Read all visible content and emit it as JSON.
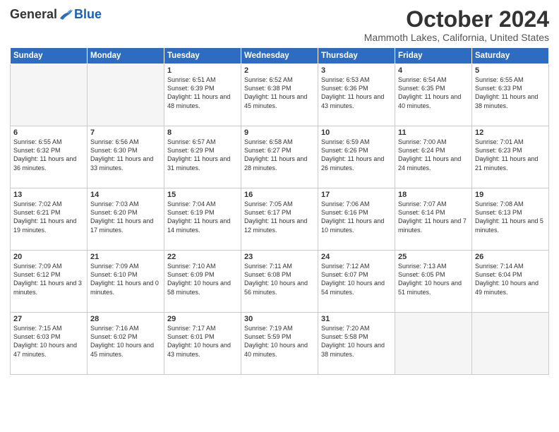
{
  "logo": {
    "general": "General",
    "blue": "Blue"
  },
  "title": "October 2024",
  "location": "Mammoth Lakes, California, United States",
  "weekdays": [
    "Sunday",
    "Monday",
    "Tuesday",
    "Wednesday",
    "Thursday",
    "Friday",
    "Saturday"
  ],
  "weeks": [
    [
      {
        "day": "",
        "empty": true
      },
      {
        "day": "",
        "empty": true
      },
      {
        "day": "1",
        "sunrise": "Sunrise: 6:51 AM",
        "sunset": "Sunset: 6:39 PM",
        "daylight": "Daylight: 11 hours and 48 minutes."
      },
      {
        "day": "2",
        "sunrise": "Sunrise: 6:52 AM",
        "sunset": "Sunset: 6:38 PM",
        "daylight": "Daylight: 11 hours and 45 minutes."
      },
      {
        "day": "3",
        "sunrise": "Sunrise: 6:53 AM",
        "sunset": "Sunset: 6:36 PM",
        "daylight": "Daylight: 11 hours and 43 minutes."
      },
      {
        "day": "4",
        "sunrise": "Sunrise: 6:54 AM",
        "sunset": "Sunset: 6:35 PM",
        "daylight": "Daylight: 11 hours and 40 minutes."
      },
      {
        "day": "5",
        "sunrise": "Sunrise: 6:55 AM",
        "sunset": "Sunset: 6:33 PM",
        "daylight": "Daylight: 11 hours and 38 minutes."
      }
    ],
    [
      {
        "day": "6",
        "sunrise": "Sunrise: 6:55 AM",
        "sunset": "Sunset: 6:32 PM",
        "daylight": "Daylight: 11 hours and 36 minutes."
      },
      {
        "day": "7",
        "sunrise": "Sunrise: 6:56 AM",
        "sunset": "Sunset: 6:30 PM",
        "daylight": "Daylight: 11 hours and 33 minutes."
      },
      {
        "day": "8",
        "sunrise": "Sunrise: 6:57 AM",
        "sunset": "Sunset: 6:29 PM",
        "daylight": "Daylight: 11 hours and 31 minutes."
      },
      {
        "day": "9",
        "sunrise": "Sunrise: 6:58 AM",
        "sunset": "Sunset: 6:27 PM",
        "daylight": "Daylight: 11 hours and 28 minutes."
      },
      {
        "day": "10",
        "sunrise": "Sunrise: 6:59 AM",
        "sunset": "Sunset: 6:26 PM",
        "daylight": "Daylight: 11 hours and 26 minutes."
      },
      {
        "day": "11",
        "sunrise": "Sunrise: 7:00 AM",
        "sunset": "Sunset: 6:24 PM",
        "daylight": "Daylight: 11 hours and 24 minutes."
      },
      {
        "day": "12",
        "sunrise": "Sunrise: 7:01 AM",
        "sunset": "Sunset: 6:23 PM",
        "daylight": "Daylight: 11 hours and 21 minutes."
      }
    ],
    [
      {
        "day": "13",
        "sunrise": "Sunrise: 7:02 AM",
        "sunset": "Sunset: 6:21 PM",
        "daylight": "Daylight: 11 hours and 19 minutes."
      },
      {
        "day": "14",
        "sunrise": "Sunrise: 7:03 AM",
        "sunset": "Sunset: 6:20 PM",
        "daylight": "Daylight: 11 hours and 17 minutes."
      },
      {
        "day": "15",
        "sunrise": "Sunrise: 7:04 AM",
        "sunset": "Sunset: 6:19 PM",
        "daylight": "Daylight: 11 hours and 14 minutes."
      },
      {
        "day": "16",
        "sunrise": "Sunrise: 7:05 AM",
        "sunset": "Sunset: 6:17 PM",
        "daylight": "Daylight: 11 hours and 12 minutes."
      },
      {
        "day": "17",
        "sunrise": "Sunrise: 7:06 AM",
        "sunset": "Sunset: 6:16 PM",
        "daylight": "Daylight: 11 hours and 10 minutes."
      },
      {
        "day": "18",
        "sunrise": "Sunrise: 7:07 AM",
        "sunset": "Sunset: 6:14 PM",
        "daylight": "Daylight: 11 hours and 7 minutes."
      },
      {
        "day": "19",
        "sunrise": "Sunrise: 7:08 AM",
        "sunset": "Sunset: 6:13 PM",
        "daylight": "Daylight: 11 hours and 5 minutes."
      }
    ],
    [
      {
        "day": "20",
        "sunrise": "Sunrise: 7:09 AM",
        "sunset": "Sunset: 6:12 PM",
        "daylight": "Daylight: 11 hours and 3 minutes."
      },
      {
        "day": "21",
        "sunrise": "Sunrise: 7:09 AM",
        "sunset": "Sunset: 6:10 PM",
        "daylight": "Daylight: 11 hours and 0 minutes."
      },
      {
        "day": "22",
        "sunrise": "Sunrise: 7:10 AM",
        "sunset": "Sunset: 6:09 PM",
        "daylight": "Daylight: 10 hours and 58 minutes."
      },
      {
        "day": "23",
        "sunrise": "Sunrise: 7:11 AM",
        "sunset": "Sunset: 6:08 PM",
        "daylight": "Daylight: 10 hours and 56 minutes."
      },
      {
        "day": "24",
        "sunrise": "Sunrise: 7:12 AM",
        "sunset": "Sunset: 6:07 PM",
        "daylight": "Daylight: 10 hours and 54 minutes."
      },
      {
        "day": "25",
        "sunrise": "Sunrise: 7:13 AM",
        "sunset": "Sunset: 6:05 PM",
        "daylight": "Daylight: 10 hours and 51 minutes."
      },
      {
        "day": "26",
        "sunrise": "Sunrise: 7:14 AM",
        "sunset": "Sunset: 6:04 PM",
        "daylight": "Daylight: 10 hours and 49 minutes."
      }
    ],
    [
      {
        "day": "27",
        "sunrise": "Sunrise: 7:15 AM",
        "sunset": "Sunset: 6:03 PM",
        "daylight": "Daylight: 10 hours and 47 minutes."
      },
      {
        "day": "28",
        "sunrise": "Sunrise: 7:16 AM",
        "sunset": "Sunset: 6:02 PM",
        "daylight": "Daylight: 10 hours and 45 minutes."
      },
      {
        "day": "29",
        "sunrise": "Sunrise: 7:17 AM",
        "sunset": "Sunset: 6:01 PM",
        "daylight": "Daylight: 10 hours and 43 minutes."
      },
      {
        "day": "30",
        "sunrise": "Sunrise: 7:19 AM",
        "sunset": "Sunset: 5:59 PM",
        "daylight": "Daylight: 10 hours and 40 minutes."
      },
      {
        "day": "31",
        "sunrise": "Sunrise: 7:20 AM",
        "sunset": "Sunset: 5:58 PM",
        "daylight": "Daylight: 10 hours and 38 minutes."
      },
      {
        "day": "",
        "empty": true
      },
      {
        "day": "",
        "empty": true
      }
    ]
  ]
}
